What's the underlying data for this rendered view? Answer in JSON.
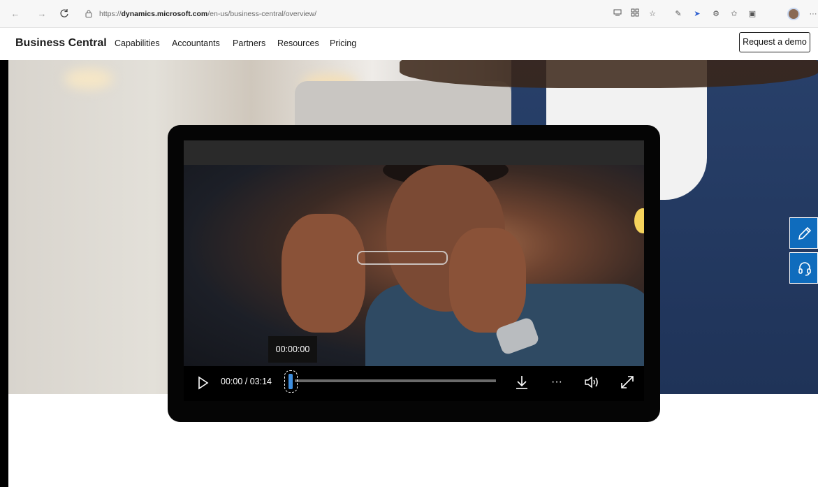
{
  "browser": {
    "url_prefix": "https://",
    "url_host": "dynamics.microsoft.com",
    "url_path": "/en-us/business-central/overview/",
    "more_label": "···"
  },
  "header": {
    "brand": "Business Central",
    "nav": [
      "Capabilities",
      "Accountants",
      "Partners",
      "Resources",
      "Pricing"
    ],
    "cta": "Request a demo"
  },
  "video": {
    "time_display": "00:00 / 03:14",
    "tooltip": "00:00:00",
    "progress": 0.0,
    "more_label": "···"
  },
  "colors": {
    "accent": "#0f6cbd",
    "scrub_thumb": "#3f8fe0"
  },
  "side_buttons": [
    "pencil-icon",
    "headset-icon"
  ]
}
